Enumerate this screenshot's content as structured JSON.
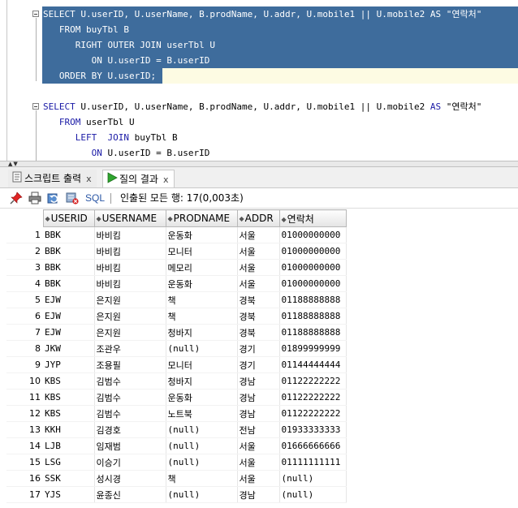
{
  "editor": {
    "query1": {
      "line1": {
        "kw1": "SELECT",
        "rest": " U.userID, U.userName, B.prodName, U.addr, U.mobile1 || U.mobile2 ",
        "kw2": "AS",
        "alias": " \"연락처\""
      },
      "line2": {
        "kw": "FROM",
        "rest": " buyTbl B"
      },
      "line3": {
        "kw": "RIGHT OUTER JOIN",
        "rest": " userTbl U"
      },
      "line4": {
        "kw": "ON",
        "rest": " U.userID = B.userID"
      },
      "line5": {
        "kw": "ORDER BY",
        "rest": " U.userID;"
      }
    },
    "query2": {
      "line1": {
        "kw1": "SELECT",
        "rest": " U.userID, U.userName, B.prodName, U.addr, U.mobile1 || U.mobile2 ",
        "kw2": "AS",
        "alias": " \"연락처\""
      },
      "line2": {
        "kw": "FROM",
        "rest": " userTbl U"
      },
      "line3": {
        "kw": "LEFT  JOIN",
        "rest": " buyTbl B"
      },
      "line4": {
        "kw": "ON",
        "rest": " U.userID = B.userID"
      }
    }
  },
  "tabs": [
    {
      "label": "스크립트 출력",
      "close": "x"
    },
    {
      "label": "질의 결과",
      "close": "x"
    }
  ],
  "toolbar": {
    "icons": [
      "pin-icon",
      "print-icon",
      "refresh-icon",
      "clear-icon"
    ],
    "sql_label": "SQL",
    "status": "인출된 모든 행: 17(0,003초)"
  },
  "grid": {
    "columns": [
      "USERID",
      "USERNAME",
      "PRODNAME",
      "ADDR",
      "연락처"
    ],
    "rows": [
      {
        "n": "1",
        "userid": "BBK",
        "username": "바비킴",
        "prodname": "운동화",
        "addr": "서울",
        "phone": "01000000000"
      },
      {
        "n": "2",
        "userid": "BBK",
        "username": "바비킴",
        "prodname": "모니터",
        "addr": "서울",
        "phone": "01000000000"
      },
      {
        "n": "3",
        "userid": "BBK",
        "username": "바비킴",
        "prodname": "메모리",
        "addr": "서울",
        "phone": "01000000000"
      },
      {
        "n": "4",
        "userid": "BBK",
        "username": "바비킴",
        "prodname": "운동화",
        "addr": "서울",
        "phone": "01000000000"
      },
      {
        "n": "5",
        "userid": "EJW",
        "username": "은지원",
        "prodname": "책",
        "addr": "경북",
        "phone": "01188888888"
      },
      {
        "n": "6",
        "userid": "EJW",
        "username": "은지원",
        "prodname": "책",
        "addr": "경북",
        "phone": "01188888888"
      },
      {
        "n": "7",
        "userid": "EJW",
        "username": "은지원",
        "prodname": "청바지",
        "addr": "경북",
        "phone": "01188888888"
      },
      {
        "n": "8",
        "userid": "JKW",
        "username": "조관우",
        "prodname": "(null)",
        "addr": "경기",
        "phone": "01899999999"
      },
      {
        "n": "9",
        "userid": "JYP",
        "username": "조용필",
        "prodname": "모니터",
        "addr": "경기",
        "phone": "01144444444"
      },
      {
        "n": "10",
        "userid": "KBS",
        "username": "김범수",
        "prodname": "청바지",
        "addr": "경남",
        "phone": "01122222222"
      },
      {
        "n": "11",
        "userid": "KBS",
        "username": "김범수",
        "prodname": "운동화",
        "addr": "경남",
        "phone": "01122222222"
      },
      {
        "n": "12",
        "userid": "KBS",
        "username": "김범수",
        "prodname": "노트북",
        "addr": "경남",
        "phone": "01122222222"
      },
      {
        "n": "13",
        "userid": "KKH",
        "username": "김경호",
        "prodname": "(null)",
        "addr": "전남",
        "phone": "01933333333"
      },
      {
        "n": "14",
        "userid": "LJB",
        "username": "임재범",
        "prodname": "(null)",
        "addr": "서울",
        "phone": "01666666666"
      },
      {
        "n": "15",
        "userid": "LSG",
        "username": "이승기",
        "prodname": "(null)",
        "addr": "서울",
        "phone": "01111111111"
      },
      {
        "n": "16",
        "userid": "SSK",
        "username": "성시경",
        "prodname": "책",
        "addr": "서울",
        "phone": "(null)"
      },
      {
        "n": "17",
        "userid": "YJS",
        "username": "윤종신",
        "prodname": "(null)",
        "addr": "경남",
        "phone": "(null)"
      }
    ]
  },
  "colors": {
    "selection": "#3e6c9c",
    "keyword": "#1a1aa6",
    "current_line": "#fdfbe3"
  }
}
